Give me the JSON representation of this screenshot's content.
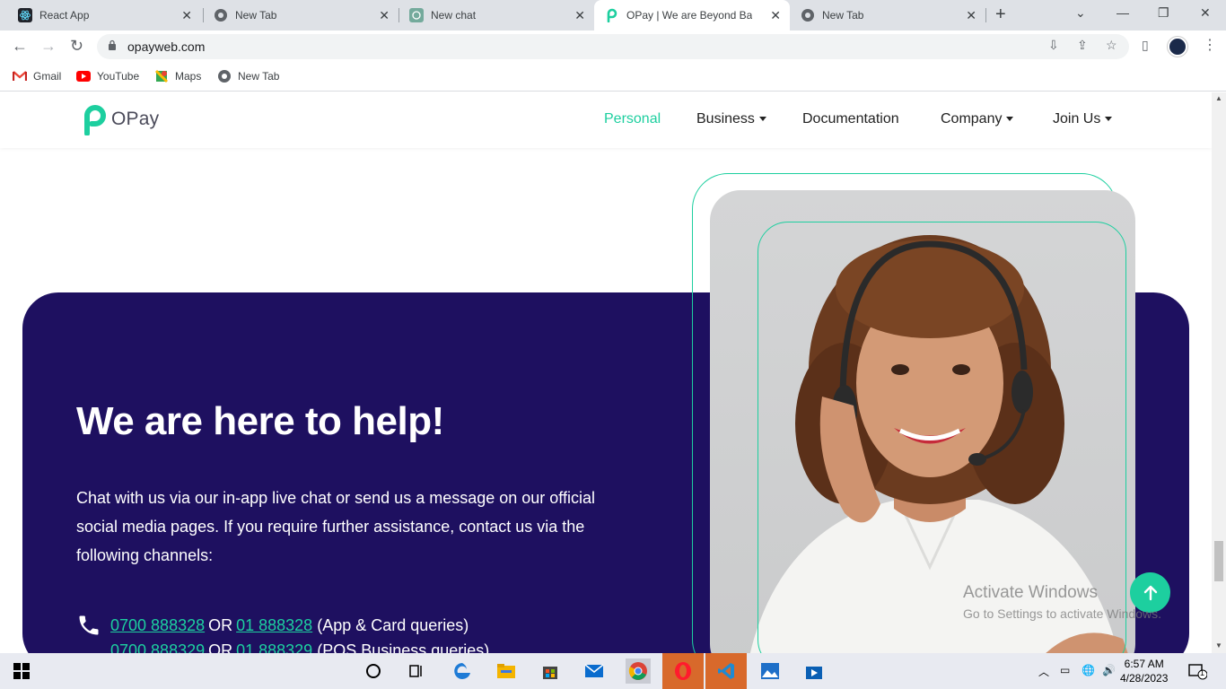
{
  "browser": {
    "tabs": [
      {
        "title": "React App",
        "icon": "react-icon",
        "active": false
      },
      {
        "title": "New Tab",
        "icon": "chrome-icon",
        "active": false
      },
      {
        "title": "New chat",
        "icon": "chatgpt-icon",
        "active": false
      },
      {
        "title": "OPay | We are Beyond Bankin",
        "icon": "opay-icon",
        "active": true
      },
      {
        "title": "New Tab",
        "icon": "chrome-icon",
        "active": false
      }
    ],
    "url": "opayweb.com",
    "bookmarks": [
      {
        "label": "Gmail",
        "icon": "gmail-icon"
      },
      {
        "label": "YouTube",
        "icon": "youtube-icon"
      },
      {
        "label": "Maps",
        "icon": "maps-icon"
      },
      {
        "label": "New Tab",
        "icon": "globe-icon"
      }
    ]
  },
  "site": {
    "logo_text": "OPay",
    "nav": {
      "personal": "Personal",
      "business": "Business",
      "documentation": "Documentation",
      "company": "Company",
      "join_us": "Join Us"
    },
    "accent_color": "#1dcf9f",
    "card_color": "#1e1060"
  },
  "help": {
    "title": "We are here to help!",
    "body": "Chat with us via our in-app live chat or send us a message on our official social media pages. If you require further assistance, contact us via the following channels:",
    "contacts": [
      {
        "num1": "0700 888328",
        "sep": "OR",
        "num2": "01 888328",
        "note": "(App & Card queries)"
      },
      {
        "num1": "0700 888329",
        "sep": "OR",
        "num2": "01 888329",
        "note": "(POS Business queries)"
      }
    ]
  },
  "watermark": {
    "line1": "Activate Windows",
    "line2": "Go to Settings to activate Windows."
  },
  "taskbar": {
    "time": "6:57 AM",
    "date": "4/28/2023",
    "notifications": "1"
  }
}
